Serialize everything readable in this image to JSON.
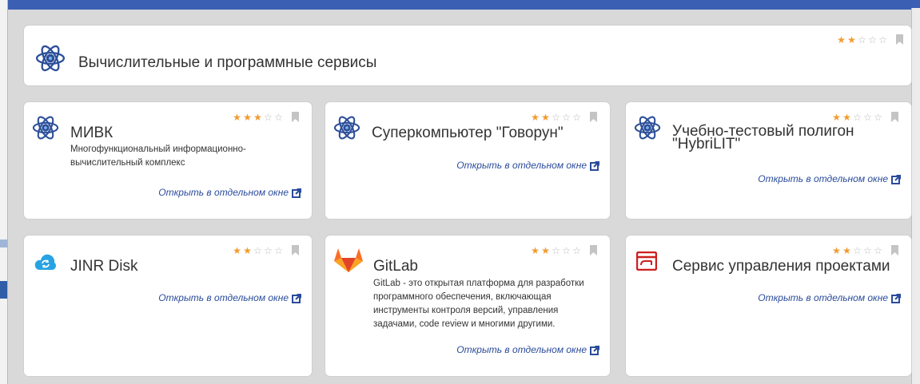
{
  "colors": {
    "accent": "#3b5fb3",
    "star_on": "#f29b2e",
    "link": "#2a4b9b"
  },
  "header_card": {
    "title": "Вычислительные и программные сервисы",
    "rating": 2,
    "icon": "atom-icon"
  },
  "cards": [
    {
      "title": "МИВК",
      "desc_lines": [
        "Многофункциональный информационно-",
        "вычислительный комплекс"
      ],
      "rating": 3,
      "icon": "atom-icon",
      "link": "Открыть в отдельном окне"
    },
    {
      "title": "Суперкомпьютер \"Говорун\"",
      "rating": 2,
      "icon": "atom-icon",
      "link": "Открыть в отдельном окне"
    },
    {
      "title_lines": [
        "Учебно-тестовый полигон",
        "\"HybriLIT\""
      ],
      "rating": 2,
      "icon": "atom-icon",
      "link": "Открыть в отдельном окне"
    },
    {
      "title": "JINR Disk",
      "rating": 2,
      "icon": "cloud-sync-icon",
      "link": "Открыть в отдельном окне"
    },
    {
      "title": "GitLab",
      "desc_lines": [
        "GitLab - это открытая платформа для разработки",
        "программного обеспечения, включающая",
        "инструменты контроля версий, управления",
        "задачами, code review и многими другими."
      ],
      "rating": 2,
      "icon": "gitlab-logo-icon",
      "link": "Открыть в отдельном окне"
    },
    {
      "title": "Сервис управления проектами",
      "rating": 2,
      "icon": "project-board-icon",
      "link": "Открыть в отдельном окне"
    }
  ]
}
